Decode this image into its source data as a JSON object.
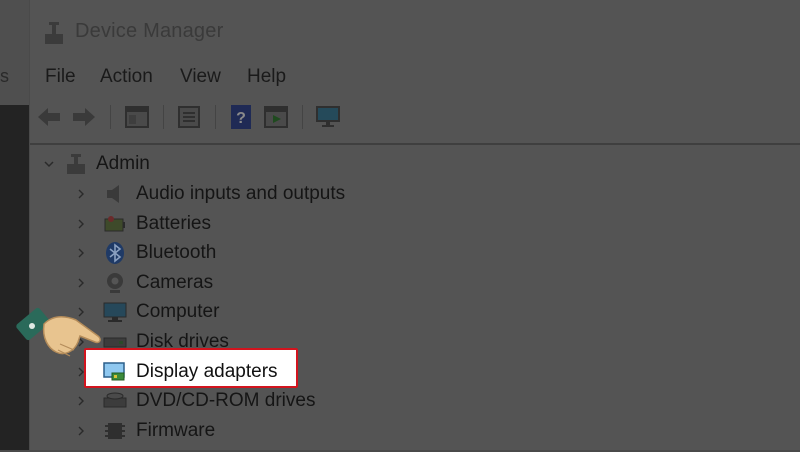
{
  "window": {
    "title": "Device Manager"
  },
  "menu": [
    "File",
    "Action",
    "View",
    "Help"
  ],
  "left_fragment": "s",
  "toolbar": {
    "buttons": [
      "back-arrow-icon",
      "forward-arrow-icon",
      "show-hide-tree-icon",
      "properties-icon",
      "help-icon",
      "run-icon",
      "monitor-scan-icon"
    ]
  },
  "tree": {
    "root": "Admin",
    "items": [
      {
        "label": "Audio inputs and outputs",
        "icon": "speaker-icon"
      },
      {
        "label": "Batteries",
        "icon": "battery-icon"
      },
      {
        "label": "Bluetooth",
        "icon": "bluetooth-icon"
      },
      {
        "label": "Cameras",
        "icon": "camera-icon"
      },
      {
        "label": "Computer",
        "icon": "computer-icon"
      },
      {
        "label": "Disk drives",
        "icon": "disk-drive-icon"
      },
      {
        "label": "Display adapters",
        "icon": "display-adapter-icon",
        "highlighted": true
      },
      {
        "label": "DVD/CD-ROM drives",
        "icon": "dvd-drive-icon"
      },
      {
        "label": "Firmware",
        "icon": "firmware-icon"
      }
    ]
  },
  "colors": {
    "overlay": "#4a4a4a",
    "highlight_border": "#d2141e",
    "highlight_fill": "#ffffff"
  }
}
